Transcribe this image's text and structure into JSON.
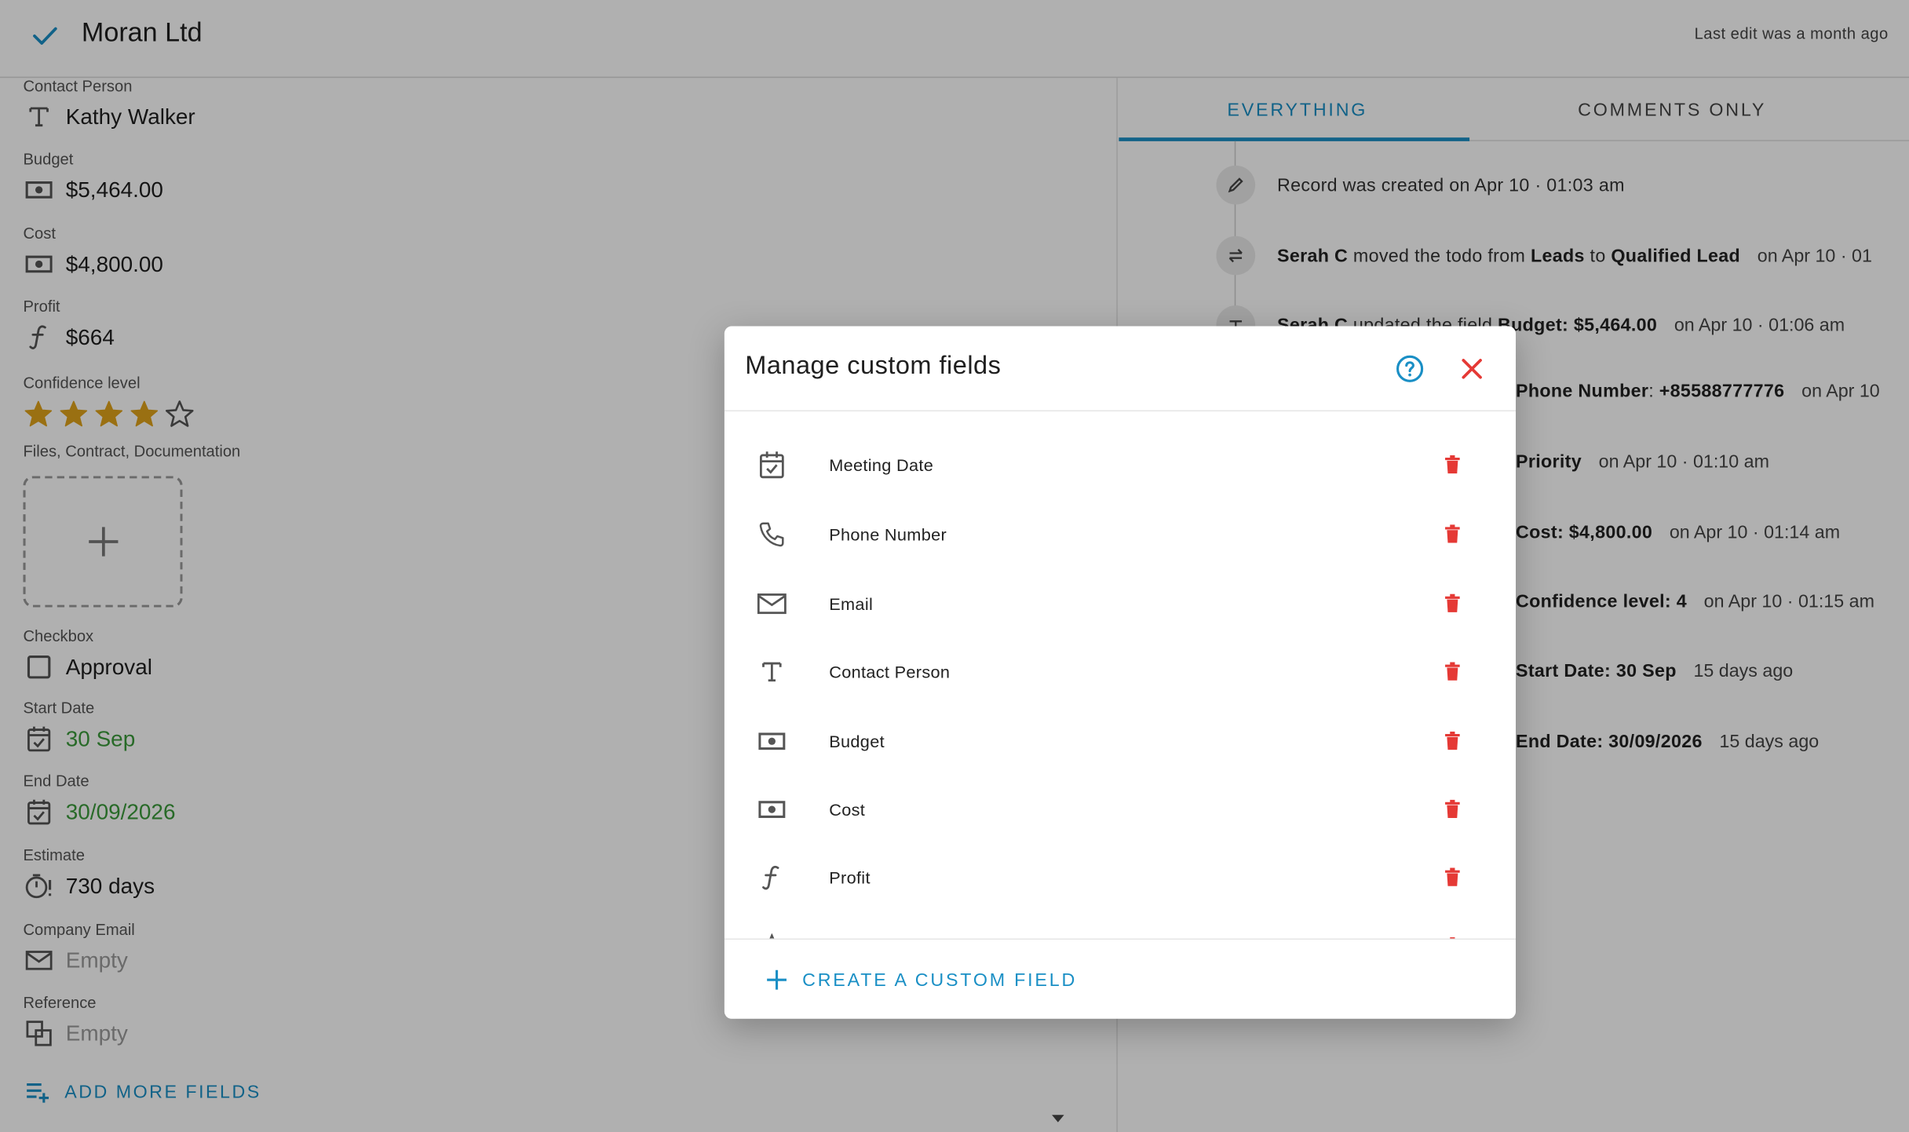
{
  "header": {
    "title": "Moran Ltd",
    "last_edit": "Last edit was a month ago"
  },
  "fields": {
    "contact_person": {
      "label": "Contact Person",
      "value": "Kathy Walker"
    },
    "budget": {
      "label": "Budget",
      "value": "$5,464.00"
    },
    "cost": {
      "label": "Cost",
      "value": "$4,800.00"
    },
    "profit": {
      "label": "Profit",
      "value": "$664"
    },
    "confidence": {
      "label": "Confidence level",
      "rating": 4,
      "max": 5
    },
    "files": {
      "label": "Files, Contract, Documentation"
    },
    "checkbox": {
      "label": "Checkbox",
      "value": "Approval"
    },
    "start_date": {
      "label": "Start Date",
      "value": "30 Sep"
    },
    "end_date": {
      "label": "End Date",
      "value": "30/09/2026"
    },
    "estimate": {
      "label": "Estimate",
      "value": "730 days"
    },
    "company_email": {
      "label": "Company Email",
      "value": "Empty"
    },
    "reference": {
      "label": "Reference",
      "value": "Empty"
    }
  },
  "add_more_fields": "ADD MORE FIELDS",
  "tabs": [
    {
      "label": "EVERYTHING",
      "active": true
    },
    {
      "label": "COMMENTS ONLY",
      "active": false
    }
  ],
  "activity": {
    "created": "Record was created on Apr 10 · 01:03 am",
    "moved": {
      "user": "Serah C",
      "text1": "moved the todo from",
      "from": "Leads",
      "text2": "to",
      "to": "Qualified Lead",
      "when": "on Apr 10 · 01"
    },
    "updated": {
      "user": "Serah C",
      "text": "updated the field",
      "field": "Budget: $5,464.00",
      "when": "on Apr 10 · 01:06 am"
    },
    "phone": {
      "field": "Phone Number",
      "value": "+85588777776",
      "when": "on Apr 10"
    },
    "priority": {
      "field": "Priority",
      "when": "on Apr 10 · 01:10 am"
    },
    "cost": {
      "field": "Cost: $4,800.00",
      "when": "on Apr 10 · 01:14 am"
    },
    "confidence": {
      "field": "Confidence level: 4",
      "when": "on Apr 10 · 01:15 am"
    },
    "start": {
      "field": "Start Date: 30 Sep",
      "when": "15 days ago"
    },
    "end": {
      "field": "End Date: 30/09/2026",
      "when": "15 days ago"
    }
  },
  "modal": {
    "title": "Manage custom fields",
    "items": [
      {
        "name": "Meeting Date",
        "icon": "calendar-check-icon"
      },
      {
        "name": "Phone Number",
        "icon": "phone-icon"
      },
      {
        "name": "Email",
        "icon": "envelope-icon"
      },
      {
        "name": "Contact Person",
        "icon": "text-icon"
      },
      {
        "name": "Budget",
        "icon": "money-icon"
      },
      {
        "name": "Cost",
        "icon": "money-icon"
      },
      {
        "name": "Profit",
        "icon": "formula-icon"
      }
    ],
    "create_label": "CREATE A CUSTOM FIELD"
  },
  "colors": {
    "accent": "#1a8fc5",
    "delete": "#e53935",
    "star": "#e0a21b",
    "date_green": "#3a9a3a"
  }
}
